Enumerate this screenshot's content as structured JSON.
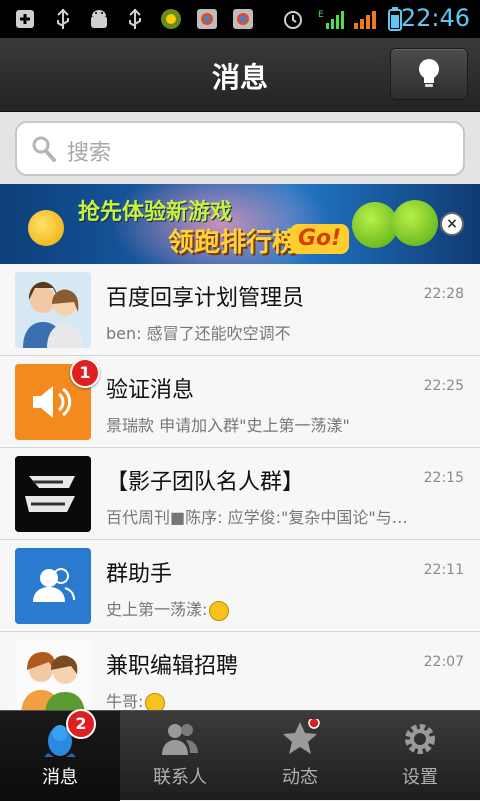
{
  "status_bar": {
    "time": "22:46",
    "signal": "E"
  },
  "header": {
    "title": "消息"
  },
  "search": {
    "placeholder": "搜索"
  },
  "banner": {
    "line1": "抢先体验新游戏",
    "line2": "领跑排行榜",
    "go": "Go!",
    "close": "×"
  },
  "conversations": [
    {
      "name": "百度回享计划管理员",
      "time": "22:28",
      "message": "ben: 感冒了还能吹空调不",
      "avatar": "two-people-avatar"
    },
    {
      "name": "验证消息",
      "time": "22:25",
      "message": "景瑞款 申请加入群\"史上第一荡漾\"",
      "avatar": "speaker-icon",
      "badge": "1"
    },
    {
      "name": "【影子团队名人群】",
      "time": "22:15",
      "message": "百代周刊■陈序: 应学俊:\"复杂中国论\"与…",
      "avatar": "shadow-logo"
    },
    {
      "name": "群助手",
      "time": "22:11",
      "message": "史上第一荡漾:",
      "avatar": "group-icon"
    },
    {
      "name": "兼职编辑招聘",
      "time": "22:07",
      "message": "牛哥:",
      "avatar": "two-people-avatar"
    }
  ],
  "tabs": [
    {
      "label": "消息",
      "badge": "2",
      "icon": "penguin-icon"
    },
    {
      "label": "联系人",
      "icon": "contacts-icon"
    },
    {
      "label": "动态",
      "icon": "star-icon"
    },
    {
      "label": "设置",
      "icon": "gear-icon"
    }
  ],
  "colors": {
    "accent_blue": "#2a7ad0",
    "badge_red": "#e02020",
    "time_cyan": "#5fc8f0"
  }
}
